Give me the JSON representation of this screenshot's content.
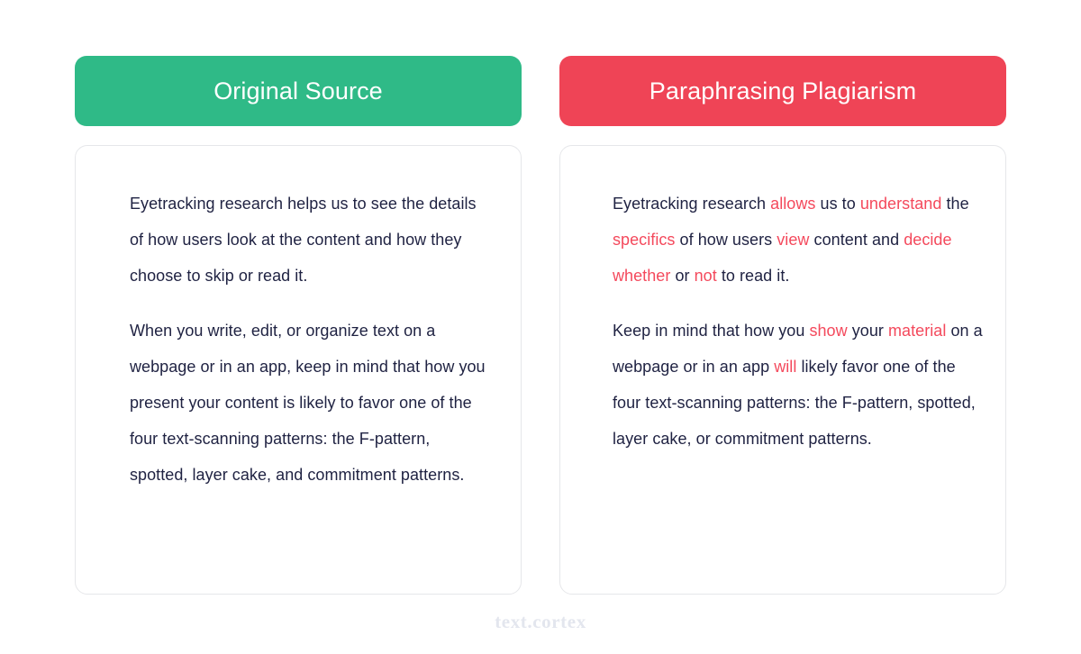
{
  "meta": {
    "watermark": "text.cortex",
    "colors": {
      "original_header_bg": "#2fba87",
      "plagiarism_header_bg": "#ef4456",
      "highlight_text": "#f4495c",
      "body_text": "#1f2242",
      "card_border": "#e6e7ea",
      "page_bg": "#ffffff",
      "watermark_text": "#e3e6ee"
    }
  },
  "columns": [
    {
      "id": "original-source",
      "header": "Original Source",
      "paragraphs": [
        {
          "id": "original-paragraph-1",
          "runs": [
            {
              "text": "Eyetracking research helps us to see the details of how users look at the content and how they choose to skip or read it.",
              "highlight": false
            }
          ]
        },
        {
          "id": "original-paragraph-2",
          "runs": [
            {
              "text": "When you write, edit, or organize text on a webpage or in an app, keep in mind that how you present your content is likely to favor one of the four text-scanning patterns: the F-pattern, spotted, layer cake, and commitment patterns.",
              "highlight": false
            }
          ]
        }
      ]
    },
    {
      "id": "paraphrasing-plagiarism",
      "header": "Paraphrasing Plagiarism",
      "paragraphs": [
        {
          "id": "plagiarism-paragraph-1",
          "runs": [
            {
              "text": "Eyetracking research ",
              "highlight": false
            },
            {
              "text": "allows",
              "highlight": true
            },
            {
              "text": " us to ",
              "highlight": false
            },
            {
              "text": "understand",
              "highlight": true
            },
            {
              "text": " the ",
              "highlight": false
            },
            {
              "text": "specifics",
              "highlight": true
            },
            {
              "text": " of how users ",
              "highlight": false
            },
            {
              "text": "view",
              "highlight": true
            },
            {
              "text": " content and ",
              "highlight": false
            },
            {
              "text": "decide whether",
              "highlight": true
            },
            {
              "text": " or ",
              "highlight": false
            },
            {
              "text": "not",
              "highlight": true
            },
            {
              "text": " to read it.",
              "highlight": false
            }
          ]
        },
        {
          "id": "plagiarism-paragraph-2",
          "runs": [
            {
              "text": "Keep in mind that how you ",
              "highlight": false
            },
            {
              "text": "show",
              "highlight": true
            },
            {
              "text": " your ",
              "highlight": false
            },
            {
              "text": "material",
              "highlight": true
            },
            {
              "text": " on a webpage or in an app ",
              "highlight": false
            },
            {
              "text": "will",
              "highlight": true
            },
            {
              "text": " likely favor one of the four text-scanning patterns: the F-pattern, spotted, layer cake, or commitment patterns.",
              "highlight": false
            }
          ]
        }
      ]
    }
  ]
}
